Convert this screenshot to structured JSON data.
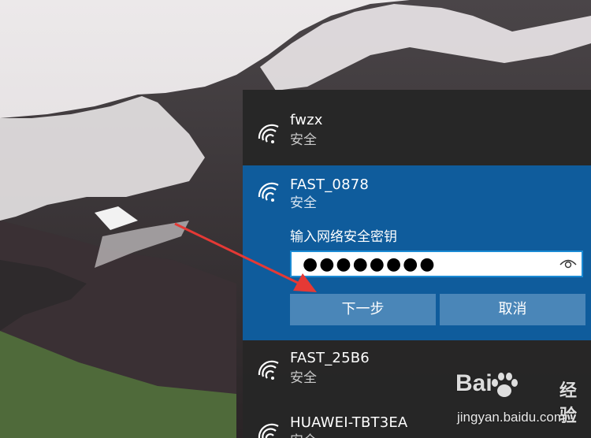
{
  "wifi_flyout": {
    "networks": [
      {
        "ssid": "fwzx",
        "security": "安全",
        "icon": "wifi-signal-icon"
      },
      {
        "ssid": "FAST_0878",
        "security": "安全",
        "icon": "wifi-signal-icon",
        "selected": true
      },
      {
        "ssid": "FAST_25B6",
        "security": "安全",
        "icon": "wifi-signal-icon"
      },
      {
        "ssid": "HUAWEI-TBT3EA",
        "security": "安全",
        "icon": "wifi-signal-icon"
      }
    ],
    "connect_form": {
      "key_label": "输入网络安全密钥",
      "password_masked": "●●●●●●●●",
      "reveal_icon": "eye-icon",
      "next_label": "下一步",
      "cancel_label": "取消"
    }
  },
  "watermark": {
    "brand_left": "Bai",
    "brand_right": "经验",
    "url": "jingyan.baidu.com"
  },
  "colors": {
    "flyout_bg": "#262626",
    "selected_bg": "#0f5c9c",
    "button_bg": "#4a86b8",
    "input_border": "#1a8ad4",
    "annotation_arrow": "#e53935"
  }
}
